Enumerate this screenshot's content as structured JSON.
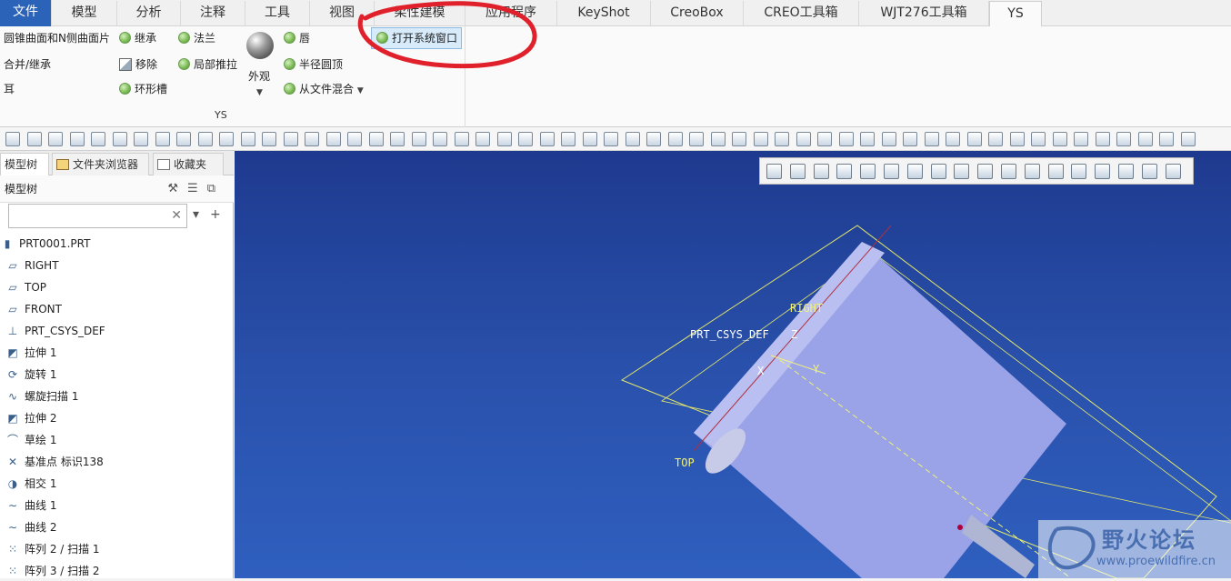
{
  "tabs": [
    "文件",
    "模型",
    "分析",
    "注释",
    "工具",
    "视图",
    "柔性建模",
    "应用程序",
    "KeyShot",
    "CreoBox",
    "CREO工具箱",
    "WJT276工具箱",
    "YS"
  ],
  "active_tab": "YS",
  "ribbon": {
    "col1": [
      "圆锥曲面和N侧曲面片",
      "合并/继承",
      "耳"
    ],
    "col2": [
      "继承",
      "移除",
      "环形槽"
    ],
    "col3": [
      "法兰",
      "局部推拉"
    ],
    "appearance_label": "外观",
    "col4": [
      "唇",
      "半径圆顶",
      "从文件混合"
    ],
    "open_system_window": "打开系统窗口",
    "group_label": "YS"
  },
  "panel_tabs": [
    "模型树",
    "文件夹浏览器",
    "收藏夹"
  ],
  "tree_header": "模型树",
  "search": {
    "value": "",
    "placeholder": ""
  },
  "tree_items": [
    {
      "icon": "part-icon",
      "label": "PRT0001.PRT"
    },
    {
      "icon": "datum-plane-icon",
      "label": "RIGHT"
    },
    {
      "icon": "datum-plane-icon",
      "label": "TOP"
    },
    {
      "icon": "datum-plane-icon",
      "label": "FRONT"
    },
    {
      "icon": "csys-icon",
      "label": "PRT_CSYS_DEF"
    },
    {
      "icon": "extrude-icon",
      "label": "拉伸 1"
    },
    {
      "icon": "revolve-icon",
      "label": "旋转 1"
    },
    {
      "icon": "helical-sweep-icon",
      "label": "螺旋扫描 1"
    },
    {
      "icon": "extrude-icon",
      "label": "拉伸 2"
    },
    {
      "icon": "sketch-icon",
      "label": "草绘 1"
    },
    {
      "icon": "datum-point-icon",
      "label": "基准点 标识138"
    },
    {
      "icon": "intersect-icon",
      "label": "相交 1"
    },
    {
      "icon": "curve-icon",
      "label": "曲线 1"
    },
    {
      "icon": "curve-icon",
      "label": "曲线 2"
    },
    {
      "icon": "pattern-icon",
      "label": "阵列 2 / 扫描 1"
    },
    {
      "icon": "pattern-icon",
      "label": "阵列 3 / 扫描 2"
    }
  ],
  "viewport_labels": {
    "right": "RIGHT",
    "csys": "PRT_CSYS_DEF",
    "top": "TOP",
    "x": "X",
    "y": "Y",
    "z": "Z"
  },
  "watermark": {
    "title": "野火论坛",
    "url": "www.proewildfire.cn"
  },
  "colors": {
    "file_tab": "#2b63b8",
    "viewport_top": "#1e3a8f",
    "annotation": "#e0202a",
    "part": "#9aa3e8"
  }
}
